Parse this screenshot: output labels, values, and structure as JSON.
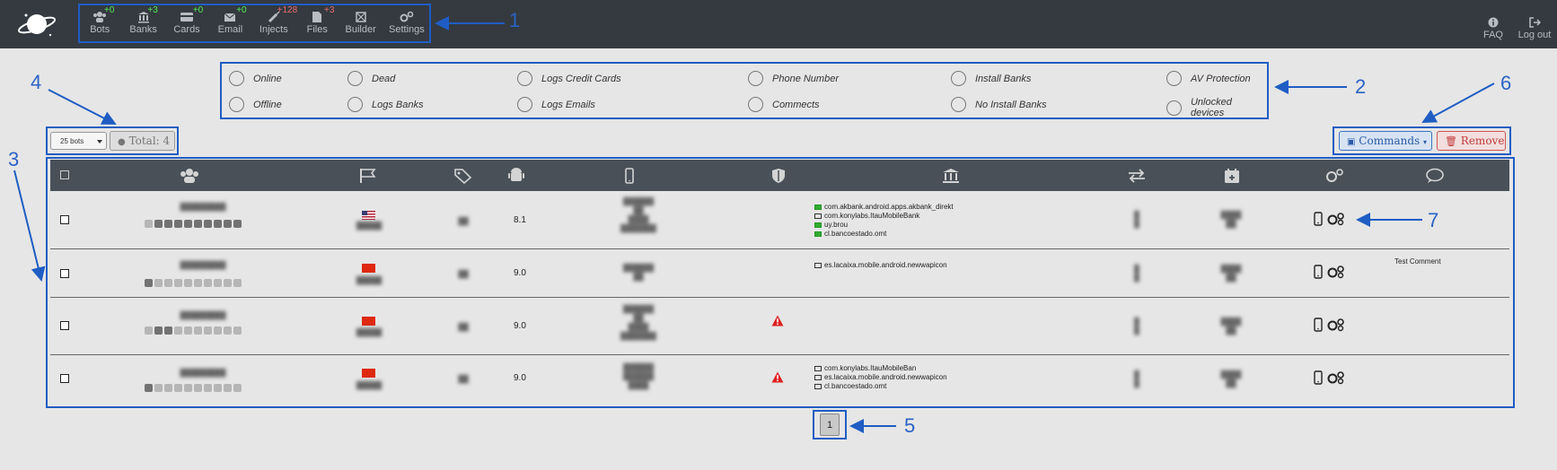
{
  "nav": {
    "items": [
      {
        "label": "Bots",
        "count": "+0",
        "icon": "users-icon",
        "count_color": "green"
      },
      {
        "label": "Banks",
        "count": "+3",
        "icon": "bank-icon",
        "count_color": "green"
      },
      {
        "label": "Cards",
        "count": "+0",
        "icon": "credit-card-icon",
        "count_color": "green"
      },
      {
        "label": "Email",
        "count": "+0",
        "icon": "envelope-icon",
        "count_color": "green"
      },
      {
        "label": "Injects",
        "count": "+128",
        "icon": "syringe-icon",
        "count_color": "red"
      },
      {
        "label": "Files",
        "count": "+3",
        "icon": "file-icon",
        "count_color": "red"
      },
      {
        "label": "Builder",
        "count": "",
        "icon": "builder-icon",
        "count_color": ""
      },
      {
        "label": "Settings",
        "count": "",
        "icon": "gears-icon",
        "count_color": ""
      }
    ],
    "right": [
      {
        "label": "FAQ",
        "icon": "info-icon"
      },
      {
        "label": "Log out",
        "icon": "logout-icon"
      }
    ]
  },
  "filters": [
    {
      "label": "Online"
    },
    {
      "label": "Offline"
    },
    {
      "label": "Dead"
    },
    {
      "label": "Logs Banks"
    },
    {
      "label": "Logs Credit Cards"
    },
    {
      "label": "Logs Emails"
    },
    {
      "label": "Phone Number"
    },
    {
      "label": "Commects"
    },
    {
      "label": "Install Banks"
    },
    {
      "label": "No Install Banks"
    },
    {
      "label": "AV Protection"
    },
    {
      "label": "Unlocked devices"
    }
  ],
  "toolbar": {
    "per_page": "25 bots",
    "total": "Total: 4",
    "commands_label": "Commands",
    "remove_label": "Remove"
  },
  "table": {
    "rows": [
      {
        "version": "8.1",
        "flag": "us",
        "warning": false,
        "apps": [
          {
            "name": "com.akbank.android.apps.akbank_direkt",
            "icon": "bank-icon"
          },
          {
            "name": "com.konylabs.ItauMobileBank",
            "icon": "envelope-icon"
          },
          {
            "name": "uy.brou",
            "icon": "bank-icon"
          },
          {
            "name": "cl.bancoestado.omt",
            "icon": "credit-card-icon"
          }
        ],
        "comment": ""
      },
      {
        "version": "9.0",
        "flag": "cn",
        "warning": false,
        "apps": [
          {
            "name": "es.lacaixa.mobile.android.newwapicon",
            "icon": "bank-icon"
          }
        ],
        "comment": "Test Comment"
      },
      {
        "version": "9.0",
        "flag": "cn",
        "warning": true,
        "apps": [],
        "comment": ""
      },
      {
        "version": "9.0",
        "flag": "cn",
        "warning": true,
        "apps": [
          {
            "name": "com.konylabs.ItauMobileBan",
            "icon": "credit-card-icon"
          },
          {
            "name": "es.lacaixa.mobile.android.newwapicon",
            "icon": "envelope-icon"
          },
          {
            "name": "cl.bancoestado.omt",
            "icon": "envelope-icon"
          }
        ],
        "comment": ""
      }
    ]
  },
  "pager": {
    "current": "1"
  },
  "annotations": [
    "1",
    "2",
    "3",
    "4",
    "5",
    "6",
    "7"
  ],
  "colors": {
    "annotation": "#1f5dc4",
    "nav_bg": "#343a40",
    "table_head": "#495057"
  }
}
